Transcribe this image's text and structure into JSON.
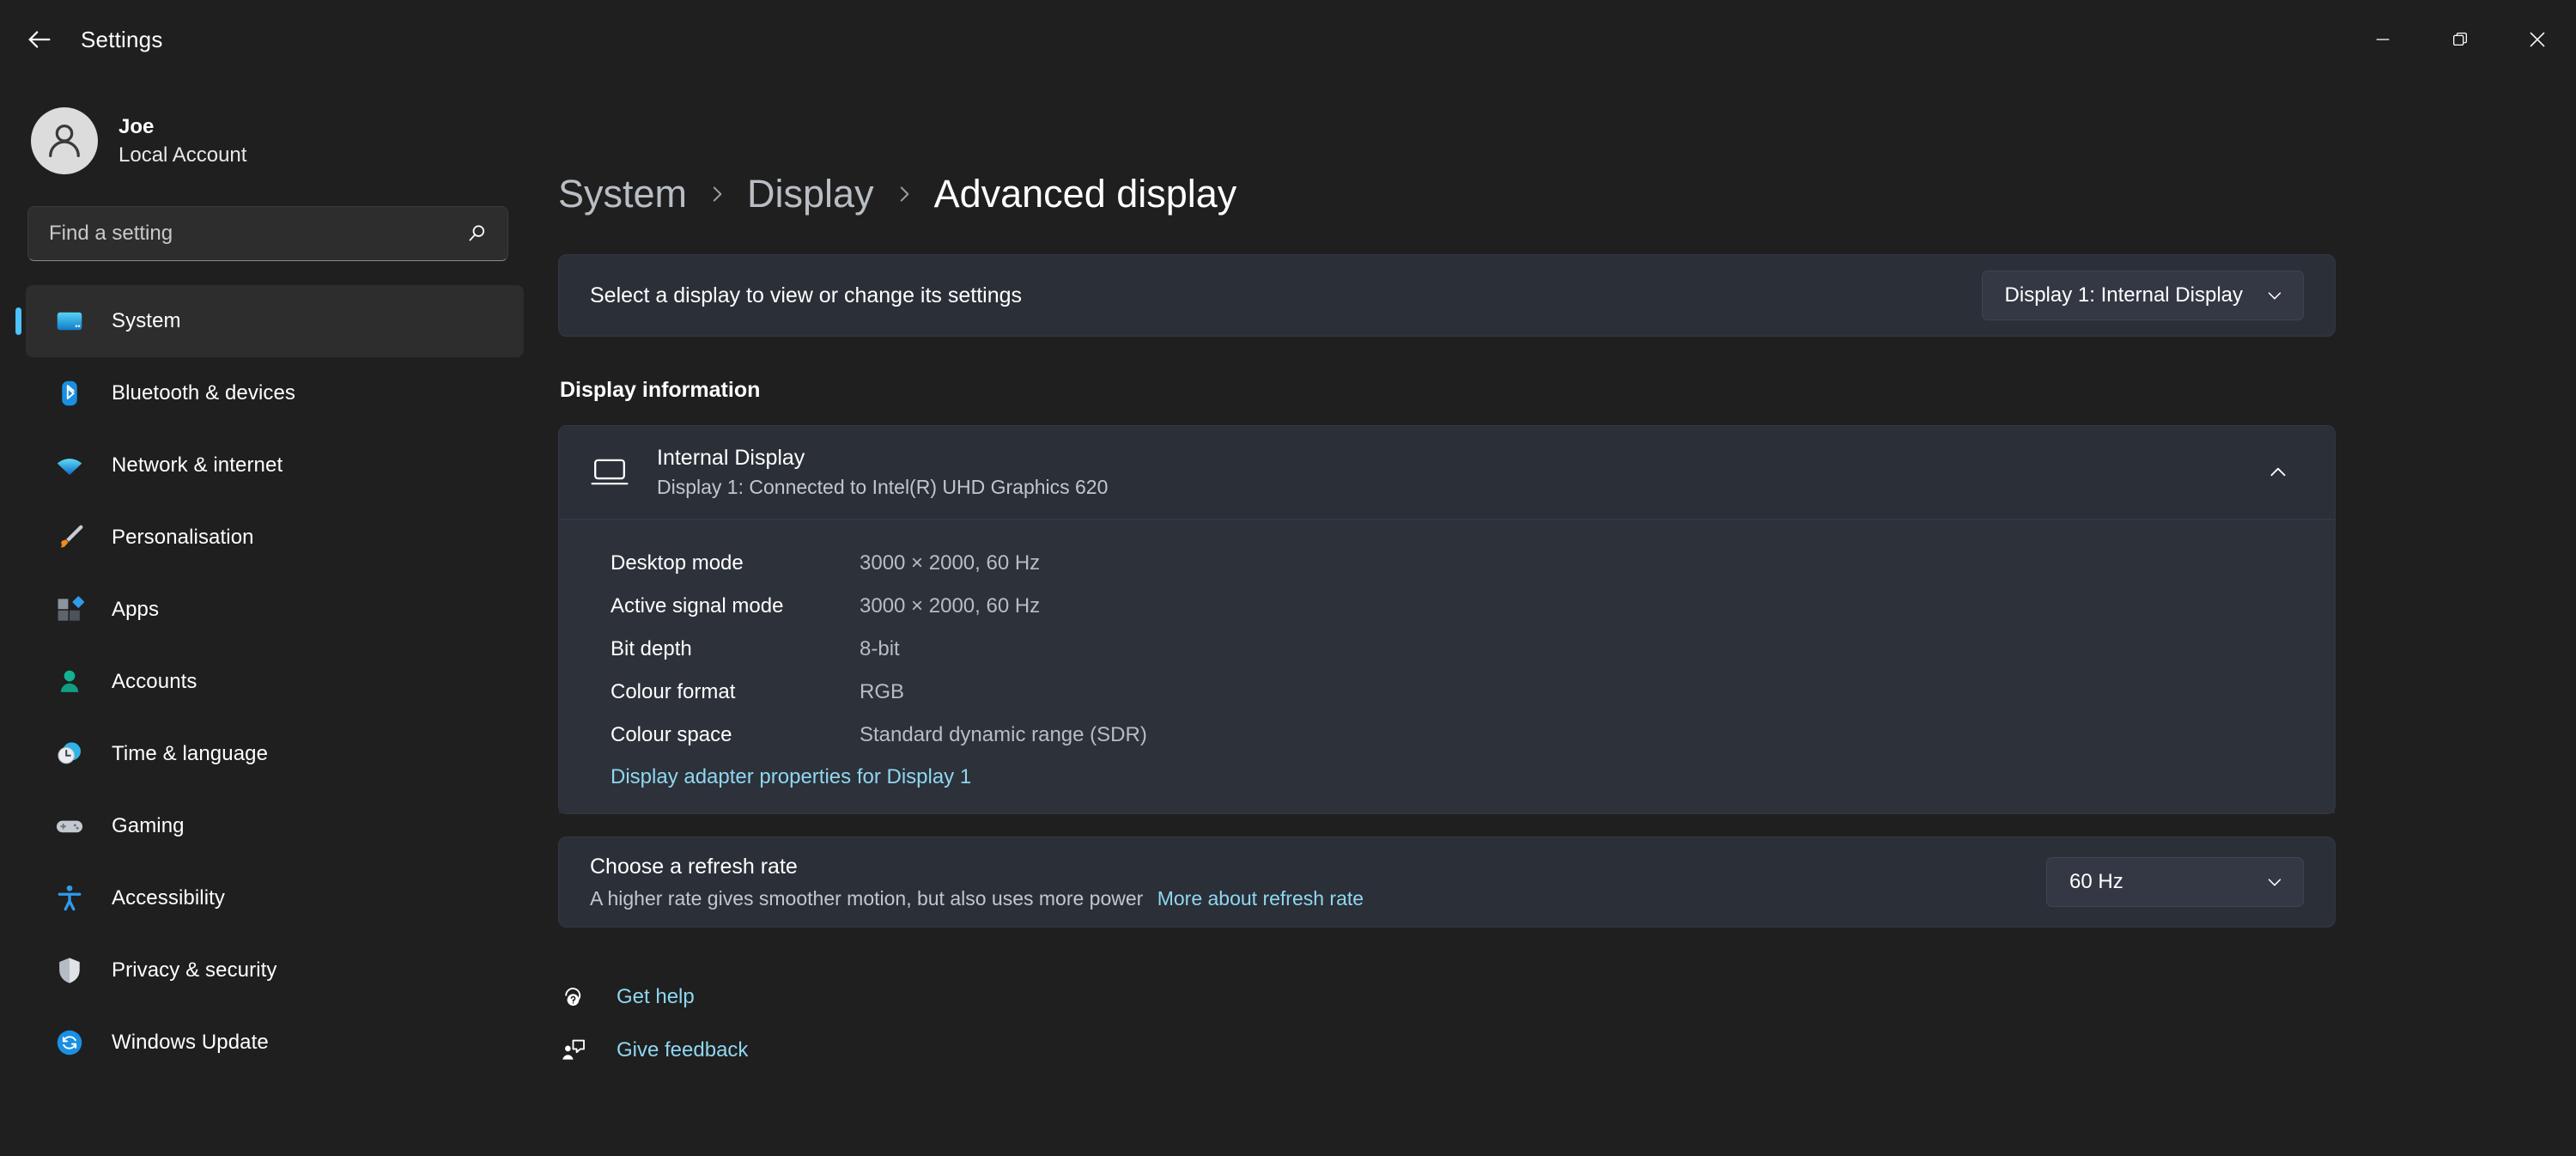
{
  "titlebar": {
    "back_label": "back-arrow",
    "app_title": "Settings",
    "minimize": "minimize",
    "restore": "restore",
    "close": "close"
  },
  "sidebar": {
    "profile": {
      "name": "Joe",
      "account_type": "Local Account"
    },
    "search": {
      "placeholder": "Find a setting",
      "value": "",
      "icon": "search-icon"
    },
    "items": [
      {
        "label": "System",
        "icon": "system-icon",
        "active": true
      },
      {
        "label": "Bluetooth & devices",
        "icon": "bluetooth-icon",
        "active": false
      },
      {
        "label": "Network & internet",
        "icon": "network-icon",
        "active": false
      },
      {
        "label": "Personalisation",
        "icon": "paintbrush-icon",
        "active": false
      },
      {
        "label": "Apps",
        "icon": "apps-icon",
        "active": false
      },
      {
        "label": "Accounts",
        "icon": "accounts-icon",
        "active": false
      },
      {
        "label": "Time & language",
        "icon": "clock-globe-icon",
        "active": false
      },
      {
        "label": "Gaming",
        "icon": "gamepad-icon",
        "active": false
      },
      {
        "label": "Accessibility",
        "icon": "accessibility-icon",
        "active": false
      },
      {
        "label": "Privacy & security",
        "icon": "shield-icon",
        "active": false
      },
      {
        "label": "Windows Update",
        "icon": "update-icon",
        "active": false
      }
    ]
  },
  "breadcrumb": {
    "root": "System",
    "parent": "Display",
    "current": "Advanced display",
    "separator": "chevron-right-icon"
  },
  "display_selector": {
    "label": "Select a display to view or change its settings",
    "selected": "Display 1: Internal Display",
    "chevron": "chevron-down-icon"
  },
  "display_information": {
    "section_title": "Display information",
    "monitor_icon": "monitor-icon",
    "name": "Internal Display",
    "subtitle": "Display 1: Connected to Intel(R) UHD Graphics 620",
    "collapse_icon": "chevron-up-icon",
    "specs": [
      {
        "label": "Desktop mode",
        "value": "3000 × 2000, 60 Hz"
      },
      {
        "label": "Active signal mode",
        "value": "3000 × 2000, 60 Hz"
      },
      {
        "label": "Bit depth",
        "value": "8-bit"
      },
      {
        "label": "Colour format",
        "value": "RGB"
      },
      {
        "label": "Colour space",
        "value": "Standard dynamic range (SDR)"
      }
    ],
    "adapter_link": "Display adapter properties for Display 1"
  },
  "refresh_rate": {
    "title": "Choose a refresh rate",
    "description": "A higher rate gives smoother motion, but also uses more power",
    "more_link": "More about refresh rate",
    "selected": "60 Hz",
    "chevron": "chevron-down-icon"
  },
  "footer": {
    "get_help": {
      "label": "Get help",
      "icon": "help-icon"
    },
    "give_feedback": {
      "label": "Give feedback",
      "icon": "feedback-icon"
    }
  },
  "colors": {
    "accent": "#4cc2ff",
    "link": "#8fd7f0",
    "window_bg": "#1f1f1f",
    "content_bg": "#202632",
    "card_bg": "#2b2f38"
  }
}
